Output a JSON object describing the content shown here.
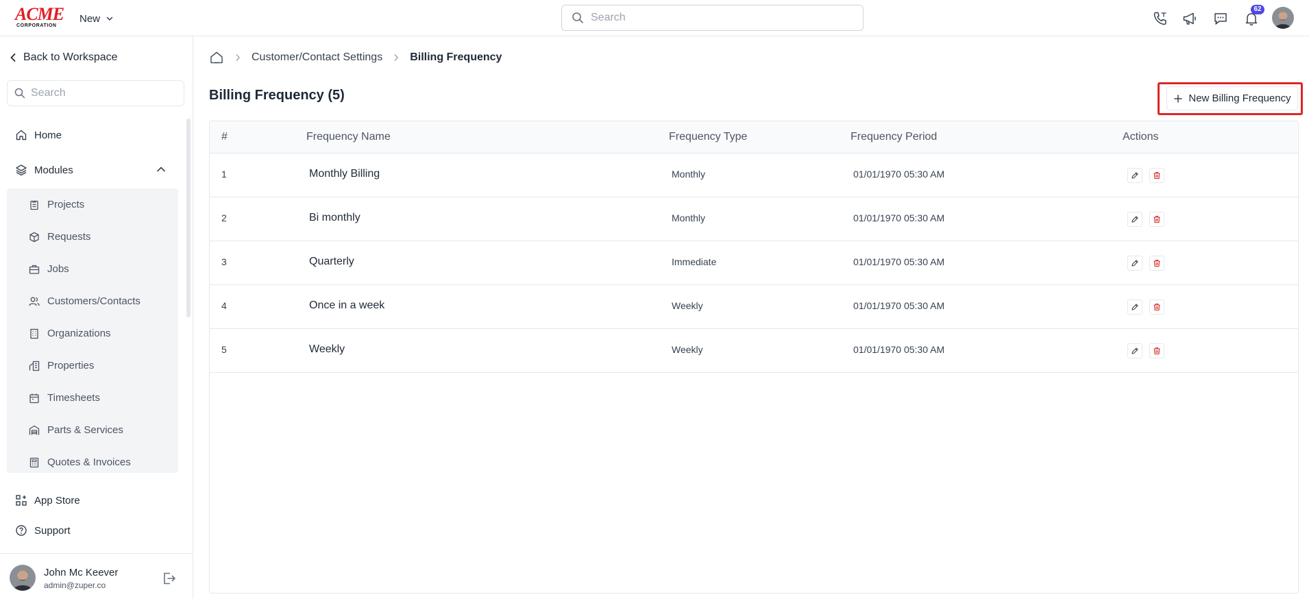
{
  "brand": {
    "logo_main": "ACME",
    "logo_sub": "CORPORATION"
  },
  "topbar": {
    "new_label": "New",
    "search_placeholder": "Search",
    "notification_count": "62"
  },
  "sidebar": {
    "back_label": "Back to Workspace",
    "search_placeholder": "Search",
    "home_label": "Home",
    "modules_label": "Modules",
    "modules": [
      {
        "label": "Projects",
        "icon": "clipboard-icon"
      },
      {
        "label": "Requests",
        "icon": "package-icon"
      },
      {
        "label": "Jobs",
        "icon": "briefcase-icon"
      },
      {
        "label": "Customers/Contacts",
        "icon": "users-icon"
      },
      {
        "label": "Organizations",
        "icon": "building-icon"
      },
      {
        "label": "Properties",
        "icon": "buildings-icon"
      },
      {
        "label": "Timesheets",
        "icon": "calendar-icon"
      },
      {
        "label": "Parts & Services",
        "icon": "warehouse-icon"
      },
      {
        "label": "Quotes & Invoices",
        "icon": "calculator-icon"
      }
    ],
    "app_store_label": "App Store",
    "support_label": "Support",
    "user": {
      "name": "John Mc Keever",
      "email": "admin@zuper.co"
    }
  },
  "breadcrumb": {
    "parent": "Customer/Contact Settings",
    "current": "Billing Frequency"
  },
  "page": {
    "title": "Billing Frequency (5)",
    "new_button": "New Billing Frequency"
  },
  "table": {
    "headers": {
      "index": "#",
      "name": "Frequency Name",
      "type": "Frequency Type",
      "period": "Frequency Period",
      "actions": "Actions"
    },
    "rows": [
      {
        "index": "1",
        "name": "Monthly Billing",
        "type": "Monthly",
        "period": "01/01/1970 05:30 AM"
      },
      {
        "index": "2",
        "name": "Bi monthly",
        "type": "Monthly",
        "period": "01/01/1970 05:30 AM"
      },
      {
        "index": "3",
        "name": "Quarterly",
        "type": "Immediate",
        "period": "01/01/1970 05:30 AM"
      },
      {
        "index": "4",
        "name": "Once in a week",
        "type": "Weekly",
        "period": "01/01/1970 05:30 AM"
      },
      {
        "index": "5",
        "name": "Weekly",
        "type": "Weekly",
        "period": "01/01/1970 05:30 AM"
      }
    ]
  },
  "colors": {
    "accent_red": "#dc2626",
    "badge": "#4f46e5",
    "logo_red": "#e11d24"
  }
}
